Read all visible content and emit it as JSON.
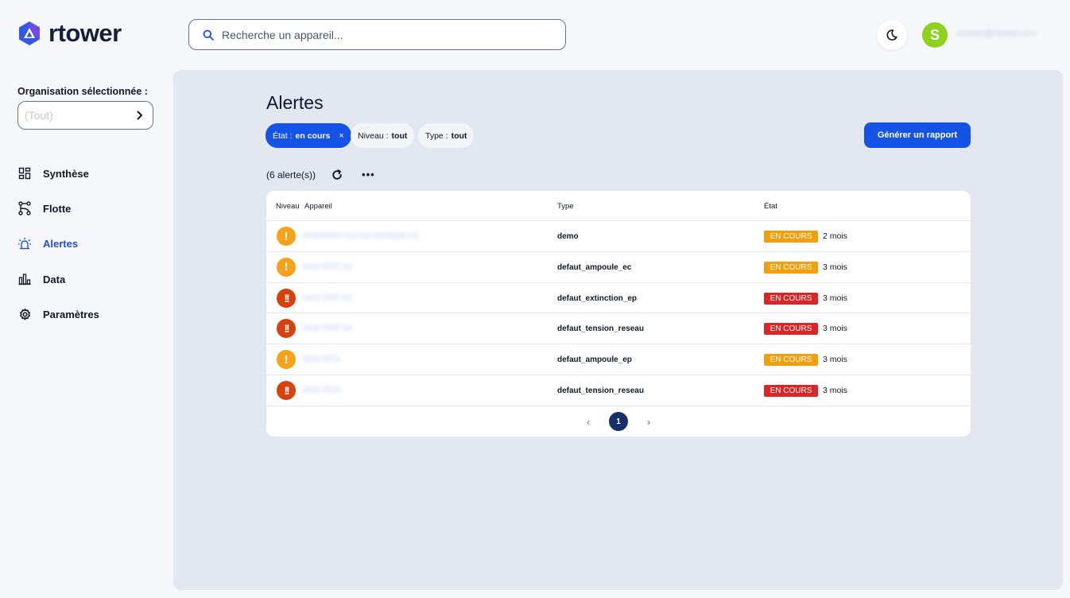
{
  "brand": {
    "name": "rtower"
  },
  "search": {
    "placeholder": "Recherche un appareil..."
  },
  "user": {
    "initial": "S",
    "email": "contact@rtower.com"
  },
  "sidebar": {
    "org_label": "Organisation sélectionnée :",
    "org_value": "(Tout)",
    "items": [
      {
        "label": "Synthèse",
        "icon": "dashboard-icon"
      },
      {
        "label": "Flotte",
        "icon": "fleet-icon"
      },
      {
        "label": "Alertes",
        "icon": "alarm-icon",
        "active": true
      },
      {
        "label": "Data",
        "icon": "bar-chart-icon"
      },
      {
        "label": "Paramètres",
        "icon": "gear-icon"
      }
    ]
  },
  "main": {
    "title": "Alertes",
    "filters": {
      "state": {
        "prefix": "État :",
        "value": "en cours",
        "remove": "×"
      },
      "level": {
        "prefix": "Niveau :",
        "value": "tout"
      },
      "type": {
        "prefix": "Type :",
        "value": "tout"
      }
    },
    "report_button": "Générer un rapport",
    "count": "(6 alerte(s))",
    "more": "•••",
    "table": {
      "headers": {
        "level": "Niveau",
        "device": "Appareil",
        "type": "Type",
        "state": "État"
      },
      "rows": [
        {
          "level": "warning",
          "level_symbol": "!",
          "device": "lampadaire-avenue-principale-01",
          "type": "demo",
          "status": "EN COURS",
          "status_color": "#f59e0b",
          "age": "2 mois"
        },
        {
          "level": "warning",
          "level_symbol": "!",
          "device": "lamp-0321-ep",
          "type": "defaut_ampoule_ec",
          "status": "EN COURS",
          "status_color": "#f59e0b",
          "age": "3 mois"
        },
        {
          "level": "critical",
          "level_symbol": "!!",
          "device": "lamp-0547-ep",
          "type": "defaut_extinction_ep",
          "status": "EN COURS",
          "status_color": "#dc2626",
          "age": "3 mois"
        },
        {
          "level": "critical",
          "level_symbol": "!!",
          "device": "lamp-0548-ep",
          "type": "defaut_tension_reseau",
          "status": "EN COURS",
          "status_color": "#dc2626",
          "age": "3 mois"
        },
        {
          "level": "warning",
          "level_symbol": "!",
          "device": "lamp-0912",
          "type": "defaut_ampoule_ep",
          "status": "EN COURS",
          "status_color": "#f59e0b",
          "age": "3 mois"
        },
        {
          "level": "critical",
          "level_symbol": "!!",
          "device": "lamp-0913",
          "type": "defaut_tension_reseau",
          "status": "EN COURS",
          "status_color": "#dc2626",
          "age": "3 mois"
        }
      ]
    },
    "pagination": {
      "prev": "‹",
      "current": "1",
      "next": "›"
    }
  },
  "colors": {
    "accent": "#1553e6",
    "warning": "#f7a21b",
    "critical": "#d8400c",
    "avatar": "#8ed11e"
  }
}
